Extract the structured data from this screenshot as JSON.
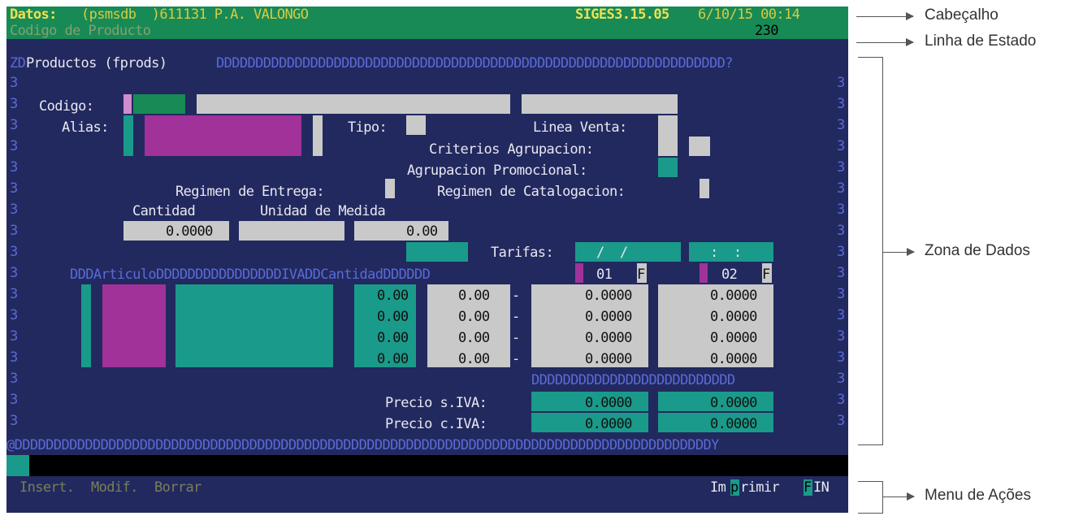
{
  "header": {
    "datos_label": "Datos:",
    "db": "(psmsdb  )611131 P.A. VALONGO",
    "version": "SIGES3.15.05",
    "datetime": "6/10/15 00:14"
  },
  "status": {
    "text": "Codigo de Producto",
    "value": "230"
  },
  "frame": {
    "top_left": "ZD",
    "title": "Productos (fprods)",
    "top_fill": "DDDDDDDDDDDDDDDDDDDDDDDDDDDDDDDDDDDDDDDDDDDDDDDDDDDDDDDDDDDDDDDDD?",
    "side": "3",
    "bottom": "@DDDDDDDDDDDDDDDDDDDDDDDDDDDDDDDDDDDDDDDDDDDDDDDDDDDDDDDDDDDDDDDDDDDDDDDDDDDDDDDDDDDDDDDDDY"
  },
  "form": {
    "codigo_label": "Codigo:",
    "alias_label": "Alias:",
    "tipo_label": "Tipo:",
    "linea_venta_label": "Linea Venta:",
    "criterios_label": "Criterios Agrupacion:",
    "agrupacion_label": "Agrupacion Promocional:",
    "regimen_entrega_label": "Regimen de Entrega:",
    "regimen_catalogacion_label": "Regimen de Catalogacion:",
    "cantidad_label": "Cantidad",
    "unidad_label": "Unidad de Medida",
    "cantidad_value": "0.0000",
    "unidad_value2": "0.00",
    "tarifas_label": "Tarifas:",
    "tarifa_date": "/  /",
    "tarifa_time": ":  :"
  },
  "grid": {
    "header_text": "DDDArticuloDDDDDDDDDDDDDDDDIVADDCantidadDDDDDD",
    "tarifa1_code": "01",
    "tarifa2_code": "02",
    "flag": "F",
    "iva": [
      "0.00",
      "0.00",
      "0.00",
      "0.00"
    ],
    "cantidad": [
      "0.00",
      "0.00",
      "0.00",
      "0.00"
    ],
    "dash": "-",
    "price1": [
      "0.0000",
      "0.0000",
      "0.0000",
      "0.0000"
    ],
    "price2": [
      "0.0000",
      "0.0000",
      "0.0000",
      "0.0000"
    ],
    "separator": "DDDDDDDDDDDDDDDDDDDDDDDDDD",
    "precio_siva_label": "Precio s.IVA:",
    "precio_civa_label": "Precio c.IVA:",
    "precio_siva": [
      "0.0000",
      "0.0000"
    ],
    "precio_civa": [
      "0.0000",
      "0.0000"
    ]
  },
  "menu": {
    "insert": "Insert.",
    "modif": "Modif.",
    "borrar": "Borrar",
    "imprimir_pre": "Im",
    "imprimir_key": "p",
    "imprimir_post": "rimir",
    "fin_key": "F",
    "fin_post": "IN"
  },
  "annotations": {
    "cabecalho": "Cabeçalho",
    "linha_estado": "Linha de Estado",
    "zona_dados": "Zona de Dados",
    "menu_acoes": "Menu de Ações"
  },
  "colors": {
    "terminal_bg": "#22295f",
    "header_bg": "#188a56",
    "field_cyan": "#1a9a8a",
    "field_magenta": "#a1329a",
    "field_grey": "#c9c9c9"
  }
}
